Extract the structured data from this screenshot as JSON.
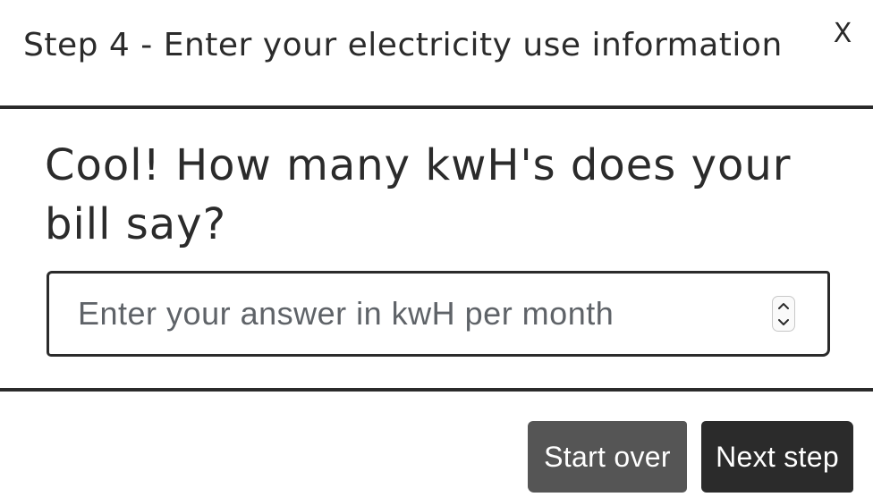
{
  "dialog": {
    "title": "Step 4 - Enter your electricity use information",
    "close_label": "X"
  },
  "question": {
    "text": "Cool! How many kwH's does your bill say?"
  },
  "answer": {
    "value": "",
    "placeholder": "Enter your answer in kwH per month"
  },
  "footer": {
    "start_over_label": "Start over",
    "next_step_label": "Next step"
  },
  "icons": {
    "stepper_up": "chevron-up-icon",
    "stepper_down": "chevron-down-icon"
  }
}
